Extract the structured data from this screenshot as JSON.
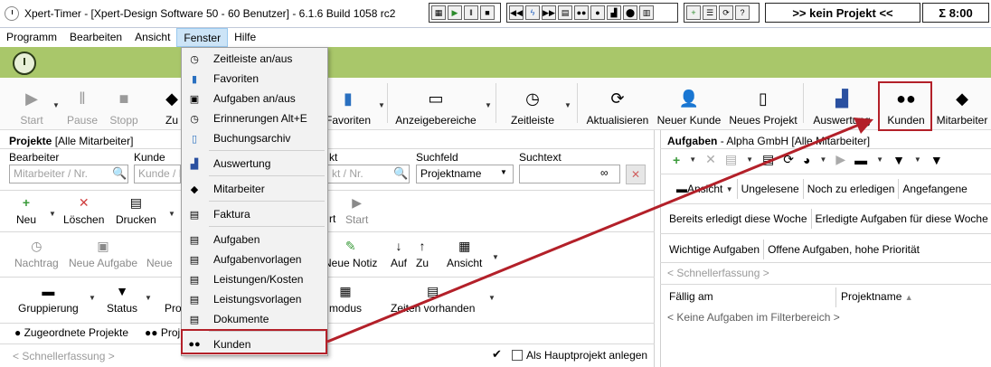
{
  "window": {
    "title": "Xpert-Timer - [Xpert-Design Software 50 - 60 Benutzer] - 6.1.6 Build 1058 rc2",
    "project_status": ">> kein Projekt <<",
    "time_sum": "Σ 8:00"
  },
  "menubar": [
    "Programm",
    "Bearbeiten",
    "Ansicht",
    "Fenster",
    "Hilfe"
  ],
  "toolbar": {
    "start": "Start",
    "pause": "Pause",
    "stopp": "Stopp",
    "zu": "Zu",
    "favoriten": "Favoriten",
    "anzeigebereiche": "Anzeigebereiche",
    "zeitleiste": "Zeitleiste",
    "aktualisieren": "Aktualisieren",
    "neuer_kunde": "Neuer Kunde",
    "neues_projekt": "Neues Projekt",
    "auswertung": "Auswertung",
    "kunden": "Kunden",
    "mitarbeiter": "Mitarbeiter"
  },
  "fenster_menu": [
    {
      "label": "Zeitleiste an/aus",
      "icon": "clock-icon"
    },
    {
      "label": "Favoriten",
      "icon": "pin-icon"
    },
    {
      "label": "Aufgaben an/aus",
      "icon": "tasks-icon"
    },
    {
      "label": "Erinnerungen Alt+E",
      "icon": "alarm-icon"
    },
    {
      "label": "Buchungsarchiv",
      "icon": "archive-icon"
    },
    {
      "label": "Auswertung",
      "icon": "chart-icon"
    },
    {
      "label": "Mitarbeiter",
      "icon": "users-icon"
    },
    {
      "label": "Faktura",
      "icon": "invoice-icon"
    },
    {
      "label": "Aufgaben",
      "icon": "tasks-icon"
    },
    {
      "label": "Aufgabenvorlagen",
      "icon": "task-template-icon"
    },
    {
      "label": "Leistungen/Kosten",
      "icon": "services-icon"
    },
    {
      "label": "Leistungsvorlagen",
      "icon": "service-template-icon"
    },
    {
      "label": "Dokumente",
      "icon": "documents-icon"
    },
    {
      "label": "Kunden",
      "icon": "customers-icon"
    }
  ],
  "projects_panel": {
    "title": "Projekte",
    "scope": "[Alle Mitarbeiter]",
    "bearbeiter_label": "Bearbeiter",
    "bearbeiter_placeholder": "Mitarbeiter / Nr.",
    "kunde_label": "Kunde",
    "kunde_placeholder": "Kunde / N",
    "projekt_label_partial": "kt",
    "projekt_placeholder_partial": "kt / Nr.",
    "suchfeld_label": "Suchfeld",
    "suchfeld_value": "Projektname",
    "suchtext_label": "Suchtext",
    "neu": "Neu",
    "loeschen": "Löschen",
    "drucken": "Drucken",
    "rt": "rt",
    "start": "Start",
    "nachtrag": "Nachtrag",
    "neue_aufgabe": "Neue Aufgabe",
    "neue_partial": "Neue",
    "neue_notiz": "Neue Notiz",
    "auf": "Auf",
    "zu": "Zu",
    "ansicht": "Ansicht",
    "gruppierung": "Gruppierung",
    "status": "Status",
    "pro_partial": "Pro",
    "modus_partial": "modus",
    "zeiten_vorhanden": "Zeiten vorhanden",
    "zugeordnete_projekte": "Zugeordnete Projekte",
    "proj_partial": "Proj",
    "schnellerfassung": "< Schnellerfassung >",
    "als_hauptprojekt": "Als Hauptprojekt anlegen"
  },
  "tasks_panel": {
    "title": "Aufgaben",
    "scope": "- Alpha GmbH [Alle Mitarbeiter]",
    "ansicht": "Ansicht",
    "ungelesene": "Ungelesene",
    "noch_zu_erledigen": "Noch zu erledigen",
    "angefangene": "Angefangene",
    "bereits_erledigt": "Bereits erledigt diese Woche",
    "erledigte_aufgaben": "Erledigte Aufgaben für diese Woche",
    "wichtige_aufgaben": "Wichtige Aufgaben",
    "offene_aufgaben": "Offene Aufgaben, hohe Priorität",
    "schnellerfassung": "< Schnellerfassung >",
    "col_faellig": "Fällig am",
    "col_projektname": "Projektname",
    "empty": "< Keine Aufgaben im Filterbereich >"
  },
  "colors": {
    "green_bar": "#a9c76a",
    "highlight_red": "#b32029",
    "menu_active": "#cce4f7"
  }
}
